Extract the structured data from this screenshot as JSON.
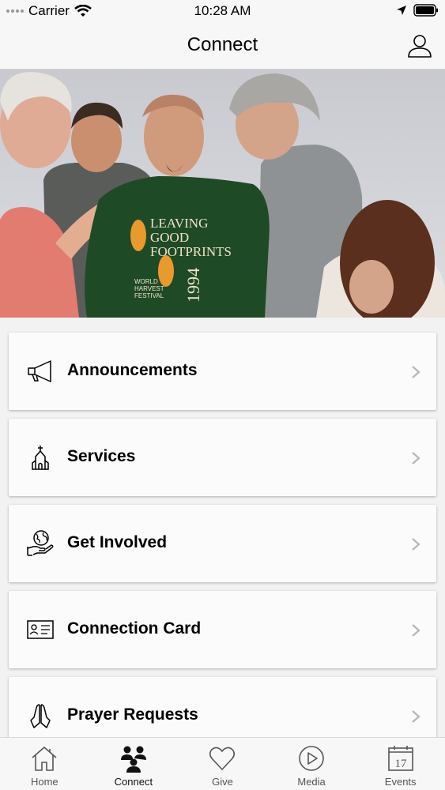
{
  "status_bar": {
    "carrier": "Carrier",
    "time": "10:28 AM"
  },
  "nav": {
    "title": "Connect",
    "profile_icon": "person-icon"
  },
  "hero": {
    "shirt_text_1": "LEAVING",
    "shirt_text_2": "GOOD",
    "shirt_text_3": "FOOTPRINTS",
    "shirt_year": "1994",
    "shirt_small_1": "WORLD",
    "shirt_small_2": "HARVEST",
    "shirt_small_3": "FESTIVAL"
  },
  "menu": {
    "items": [
      {
        "label": "Announcements",
        "icon": "megaphone-icon"
      },
      {
        "label": "Services",
        "icon": "church-icon"
      },
      {
        "label": "Get Involved",
        "icon": "globe-hand-icon"
      },
      {
        "label": "Connection Card",
        "icon": "id-card-icon"
      },
      {
        "label": "Prayer Requests",
        "icon": "praying-hands-icon"
      }
    ]
  },
  "tabs": [
    {
      "label": "Home",
      "icon": "home-icon",
      "active": false
    },
    {
      "label": "Connect",
      "icon": "people-icon",
      "active": true
    },
    {
      "label": "Give",
      "icon": "heart-icon",
      "active": false
    },
    {
      "label": "Media",
      "icon": "play-icon",
      "active": false
    },
    {
      "label": "Events",
      "icon": "calendar-icon",
      "active": false,
      "date": "17"
    }
  ],
  "colors": {
    "accent": "#000000",
    "shirt_print": "#e89a2c",
    "shirt": "#1f4a26"
  }
}
